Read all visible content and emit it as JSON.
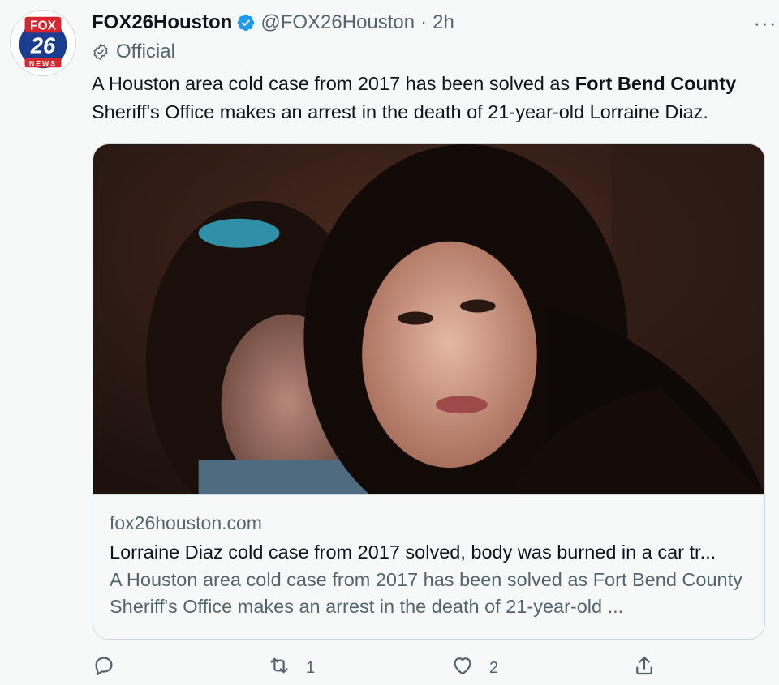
{
  "tweet": {
    "display_name": "FOX26Houston",
    "handle": "@FOX26Houston",
    "separator": "·",
    "time": "2h",
    "official_label": "Official",
    "more_label": "···",
    "text_before": "A Houston area cold case from 2017 has been solved as ",
    "text_bold": "Fort Bend County",
    "text_after": " Sheriff's Office makes an arrest in the death of 21-year-old Lorraine Diaz."
  },
  "avatar": {
    "logo_top": "FOX",
    "logo_number": "26",
    "logo_bottom": "NEWS"
  },
  "card": {
    "domain": "fox26houston.com",
    "title": "Lorraine Diaz cold case from 2017 solved, body was burned in a car tr...",
    "description": "A Houston area cold case from 2017 has been solved as Fort Bend County Sheriff's Office makes an arrest in the death of 21-year-old ..."
  },
  "actions": {
    "reply_count": "",
    "retweet_count": "1",
    "like_count": "2"
  },
  "colors": {
    "verified_blue": "#1d9bf0",
    "secondary_text": "#536471",
    "fox_red": "#d7262e",
    "fox_blue": "#1a3d8f"
  }
}
